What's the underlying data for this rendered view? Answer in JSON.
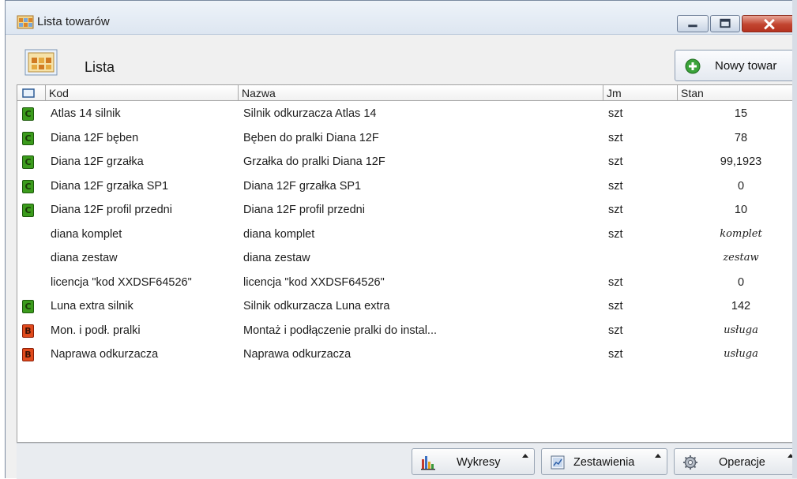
{
  "window": {
    "title": "Lista towarów"
  },
  "header": {
    "title": "Lista",
    "new_button_label": "Nowy towar"
  },
  "columns": {
    "kod": "Kod",
    "nazwa": "Nazwa",
    "jm": "Jm",
    "stan": "Stan"
  },
  "rows": [
    {
      "badge": "C",
      "kod": "Atlas 14 silnik",
      "nazwa": "Silnik odkurzacza Atlas 14",
      "jm": "szt",
      "stan": "15"
    },
    {
      "badge": "C",
      "kod": "Diana 12F bęben",
      "nazwa": "Bęben do pralki Diana 12F",
      "jm": "szt",
      "stan": "78"
    },
    {
      "badge": "C",
      "kod": "Diana 12F grzałka",
      "nazwa": "Grzałka do pralki Diana 12F",
      "jm": "szt",
      "stan": "99,1923"
    },
    {
      "badge": "C",
      "kod": "Diana 12F grzałka SP1",
      "nazwa": "Diana 12F grzałka SP1",
      "jm": "szt",
      "stan": "0"
    },
    {
      "badge": "C",
      "kod": "Diana 12F profil przedni",
      "nazwa": "Diana 12F profil przedni",
      "jm": "szt",
      "stan": "10"
    },
    {
      "badge": "",
      "kod": "diana komplet",
      "nazwa": "diana komplet",
      "jm": "szt",
      "stan": "komplet"
    },
    {
      "badge": "",
      "kod": "diana zestaw",
      "nazwa": "diana zestaw",
      "jm": "",
      "stan": "zestaw"
    },
    {
      "badge": "",
      "kod": "licencja \"kod XXDSF64526\"",
      "nazwa": "licencja \"kod XXDSF64526\"",
      "jm": "szt",
      "stan": "0"
    },
    {
      "badge": "C",
      "kod": "Luna extra silnik",
      "nazwa": "Silnik odkurzacza Luna extra",
      "jm": "szt",
      "stan": "142"
    },
    {
      "badge": "B",
      "kod": "Mon. i podł. pralki",
      "nazwa": "Montaż i podłączenie pralki do instal...",
      "jm": "szt",
      "stan": "usługa"
    },
    {
      "badge": "B",
      "kod": "Naprawa odkurzacza",
      "nazwa": "Naprawa odkurzacza",
      "jm": "szt",
      "stan": "usługa"
    }
  ],
  "toolbar": {
    "wykresy": "Wykresy",
    "zestawienia": "Zestawienia",
    "operacje": "Operacje"
  },
  "colors": {
    "badge_c": "#3b9b1c",
    "badge_b": "#e04a1c",
    "close_button": "#c24530"
  },
  "icons": {
    "title": "product-list-icon",
    "header": "product-list-icon",
    "new": "green-plus-icon",
    "wykresy": "bar-chart-icon",
    "zestawienia": "report-icon",
    "operacje": "gear-icon"
  }
}
